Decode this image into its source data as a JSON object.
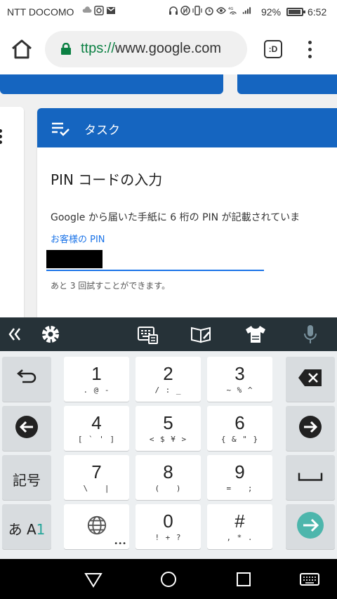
{
  "status_bar": {
    "carrier": "NTT DOCOMO",
    "network": "4G",
    "battery_percent_text": "92%",
    "battery_level": 0.92,
    "time": "6:52"
  },
  "browser": {
    "url_scheme": "ttps://",
    "url_host": "www.google.com",
    "tabs_label": ":D"
  },
  "task_card": {
    "header_title": "タスク",
    "heading": "PIN コードの入力",
    "description": "Google から届いた手紙に 6 桁の PIN が記載されていま",
    "input_label": "お客様の PIN",
    "hint": "あと 3 回試すことができます。"
  },
  "keyboard": {
    "rows": [
      [
        {
          "main": "1",
          "sub": ". @ -"
        },
        {
          "main": "2",
          "sub": "/ : _"
        },
        {
          "main": "3",
          "sub": "~ % ^"
        }
      ],
      [
        {
          "main": "4",
          "sub": "[ ` ' ]"
        },
        {
          "main": "5",
          "sub": "< $ ¥ >"
        },
        {
          "main": "6",
          "sub": "{ & \" }"
        }
      ],
      [
        {
          "main": "7",
          "sub": "\\   |"
        },
        {
          "main": "8",
          "sub": "(   )"
        },
        {
          "main": "9",
          "sub": "=   ;"
        }
      ],
      [
        {
          "main": "0",
          "sub": "! + ?"
        },
        {
          "main": "#",
          "sub": ", * ."
        }
      ]
    ],
    "symbols_label": "記号",
    "mode_label_kana": "あ",
    "mode_label_alpha": "A",
    "mode_label_num": "1",
    "colors": {
      "toolbar": "#263238",
      "enter_key": "#4db6ac",
      "accent_blue": "#1565c0"
    }
  },
  "icons": {
    "home": "home-icon",
    "lock": "lock-icon",
    "menu": "more-vert-icon",
    "task": "task-list-icon",
    "collapse": "chevron-double-left-icon",
    "settings": "gear-icon",
    "emoji": "emoji-keyboard-icon",
    "dictionary": "dictionary-icon",
    "theme": "theme-shirt-icon",
    "mic": "microphone-icon",
    "undo": "undo-icon",
    "backspace": "backspace-icon",
    "left": "arrow-left-icon",
    "right": "arrow-right-icon",
    "space": "space-icon",
    "globe": "globe-icon",
    "enter": "enter-arrow-icon",
    "nav_back": "back-triangle-icon",
    "nav_home": "home-circle-icon",
    "nav_recent": "recents-square-icon",
    "nav_keyboard": "keyboard-switch-icon"
  }
}
